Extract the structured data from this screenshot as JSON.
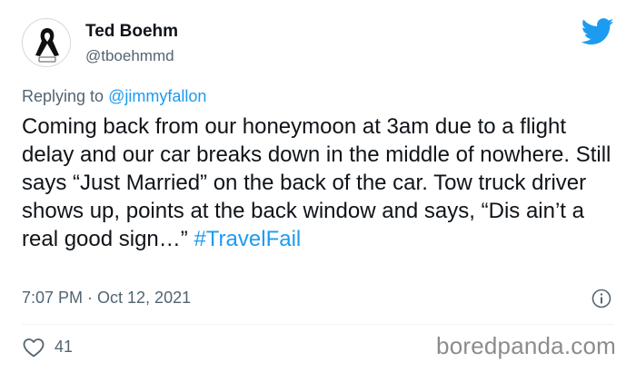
{
  "author": {
    "name": "Ted Boehm",
    "handle": "@tboehmmd",
    "avatar_icon": "black-ribbon-icon"
  },
  "platform_icon": "twitter-bird-icon",
  "reply": {
    "prefix": "Replying to",
    "mention": "@jimmyfallon"
  },
  "tweet": {
    "text": "Coming back from our honeymoon at 3am due to a flight delay and our car breaks down in the middle of nowhere. Still says “Just Married” on the back of the car.  Tow truck driver shows up, points at the back window and says, “Dis ain’t a real good sign…” ",
    "hashtag": "#TravelFail"
  },
  "meta": {
    "timestamp": "7:07 PM · Oct 12, 2021",
    "info_icon": "info-icon"
  },
  "engagement": {
    "likes": "41",
    "like_icon": "heart-icon"
  },
  "watermark": "boredpanda.com",
  "colors": {
    "link": "#1d9bf0",
    "secondary_text": "#536471",
    "primary_text": "#0f1419",
    "twitter_blue": "#1d9bf0"
  }
}
